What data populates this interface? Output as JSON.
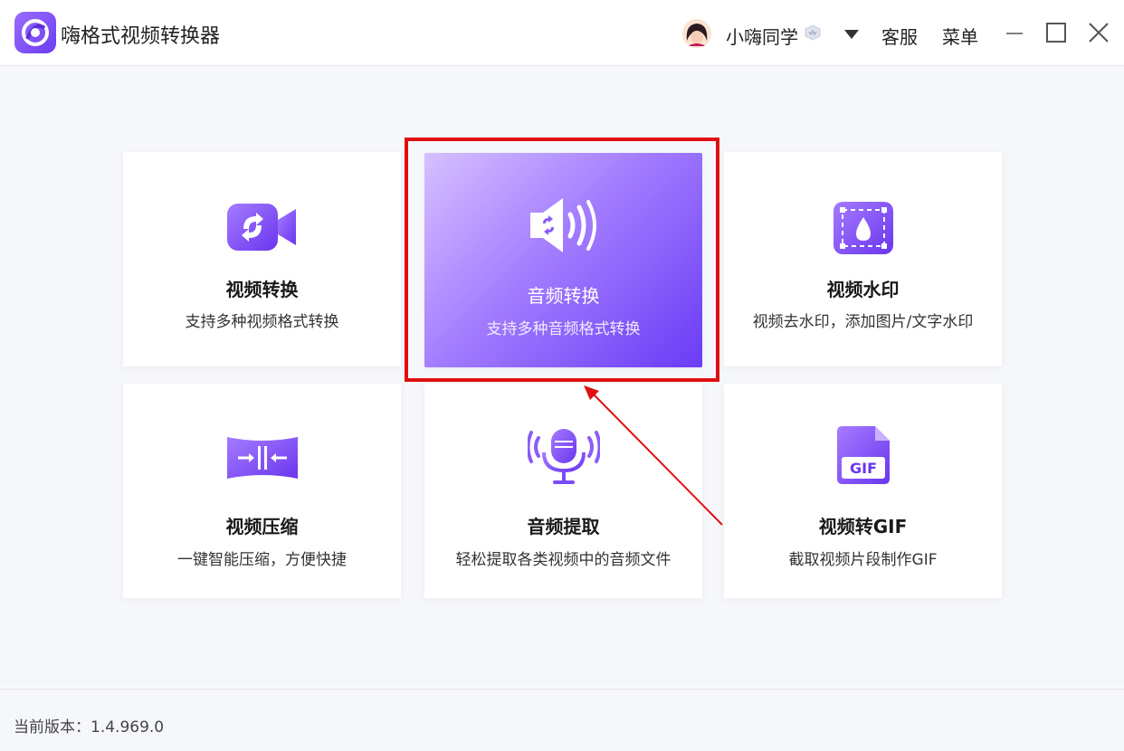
{
  "titlebar": {
    "app_title": "嗨格式视频转换器",
    "user_name": "小嗨同学",
    "support_label": "客服",
    "menu_label": "菜单"
  },
  "colors": {
    "accent": "#7a4cf5",
    "highlight": "#e01010"
  },
  "cards": [
    {
      "title": "视频转换",
      "desc": "支持多种视频格式转换",
      "icon": "video-convert-icon"
    },
    {
      "title": "音频转换",
      "desc": "支持多种音频格式转换",
      "icon": "audio-convert-icon",
      "active": true
    },
    {
      "title": "视频水印",
      "desc": "视频去水印，添加图片/文字水印",
      "icon": "watermark-icon"
    },
    {
      "title": "视频压缩",
      "desc": "一键智能压缩，方便快捷",
      "icon": "compress-icon"
    },
    {
      "title": "音频提取",
      "desc": "轻松提取各类视频中的音频文件",
      "icon": "microphone-icon"
    },
    {
      "title": "视频转GIF",
      "desc": "截取视频片段制作GIF",
      "icon": "gif-file-icon",
      "icon_text": "GIF"
    }
  ],
  "footer": {
    "version_text": "当前版本：1.4.969.0"
  }
}
